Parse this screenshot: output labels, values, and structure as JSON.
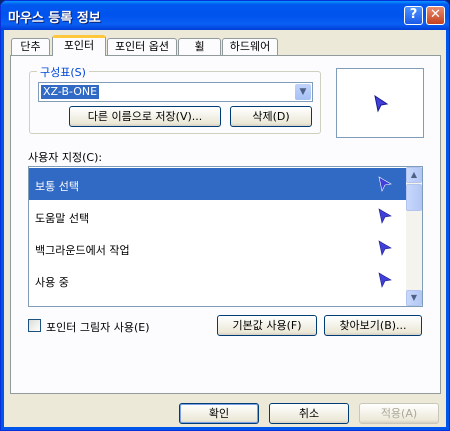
{
  "window": {
    "title": "마우스 등록 정보",
    "help_label": "?",
    "close_label": "✕"
  },
  "tabs": [
    {
      "label": "단추"
    },
    {
      "label": "포인터",
      "active": true
    },
    {
      "label": "포인터 옵션"
    },
    {
      "label": "휠"
    },
    {
      "label": "하드웨어"
    }
  ],
  "scheme": {
    "group_label": "구성표(S)",
    "selected": "XZ-B-ONE",
    "save_as_label": "다른 이름으로 저장(V)...",
    "delete_label": "삭제(D)"
  },
  "customize": {
    "label": "사용자 지정(C):",
    "items": [
      {
        "label": "보통 선택",
        "selected": true,
        "icon": "arrow-cursor-icon"
      },
      {
        "label": "도움말 선택",
        "icon": "arrow-cursor-icon"
      },
      {
        "label": "백그라운드에서 작업",
        "icon": "arrow-cursor-icon"
      },
      {
        "label": "사용 중",
        "icon": "arrow-cursor-icon"
      }
    ]
  },
  "shadow": {
    "label": "포인터 그림자 사용(E)",
    "checked": false
  },
  "buttons": {
    "default_label": "기본값 사용(F)",
    "browse_label": "찾아보기(B)...",
    "ok_label": "확인",
    "cancel_label": "취소",
    "apply_label": "적용(A)"
  },
  "colors": {
    "cursor": "#4040d8",
    "selection": "#316ac5",
    "title_bar": "#0053ee"
  }
}
